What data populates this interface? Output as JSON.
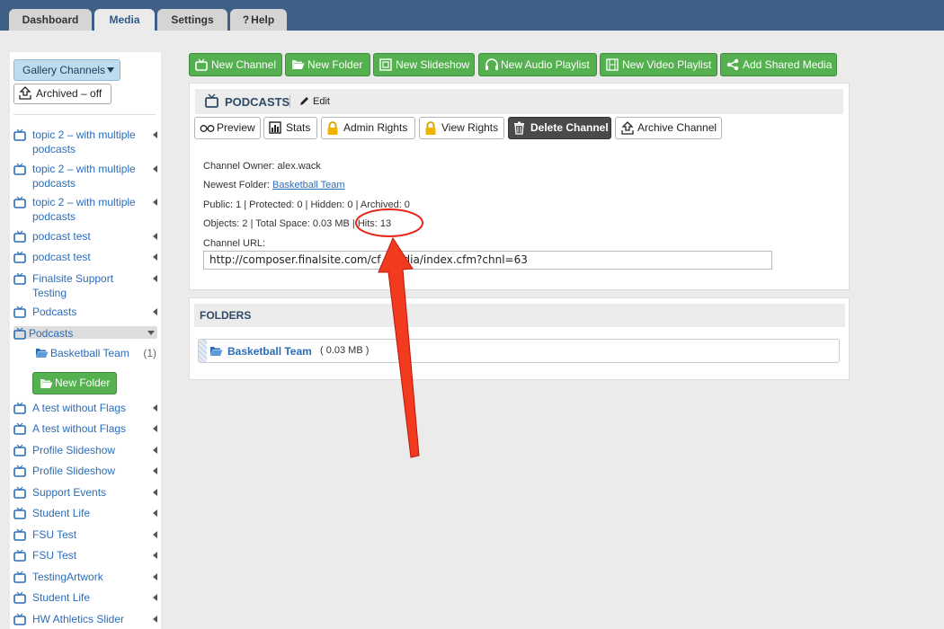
{
  "tabs": [
    {
      "label": "Dashboard",
      "active": false
    },
    {
      "label": "Media",
      "active": true
    },
    {
      "label": "Settings",
      "active": false
    },
    {
      "label": "Help",
      "active": false
    }
  ],
  "sidebar": {
    "gallery_label": "Gallery Channels",
    "archived_label": "Archived – off",
    "items": [
      {
        "label": "topic 2 – with multiple podcasts"
      },
      {
        "label": "topic 2 – with multiple podcasts"
      },
      {
        "label": "topic 2 – with multiple podcasts"
      },
      {
        "label": "podcast test"
      },
      {
        "label": "podcast test"
      },
      {
        "label": "Finalsite Support Testing"
      },
      {
        "label": "Podcasts"
      },
      {
        "label": "Podcasts"
      },
      {
        "label": "A test without Flags"
      },
      {
        "label": "A test without Flags"
      },
      {
        "label": "Profile Slideshow"
      },
      {
        "label": "Profile Slideshow"
      },
      {
        "label": "Support Events"
      },
      {
        "label": "Student Life"
      },
      {
        "label": "FSU Test"
      },
      {
        "label": "FSU Test"
      },
      {
        "label": "TestingArtwork"
      },
      {
        "label": "Student Life"
      },
      {
        "label": "HW Athletics Slider"
      }
    ],
    "sub_folder": {
      "label": "Basketball Team",
      "count": "(1)"
    },
    "new_folder_label": "New Folder"
  },
  "toolbar": {
    "new_channel": "New Channel",
    "new_folder": "New Folder",
    "new_slideshow": "New Slideshow",
    "new_audio_playlist": "New Audio Playlist",
    "new_video_playlist": "New Video Playlist",
    "add_shared_media": "Add Shared Media"
  },
  "channel": {
    "title": "PODCASTS",
    "edit_label": "Edit",
    "buttons": {
      "preview": "Preview",
      "stats": "Stats",
      "admin_rights": "Admin Rights",
      "view_rights": "View Rights",
      "delete_channel": "Delete Channel",
      "archive_channel": "Archive Channel"
    },
    "owner_text": "Channel Owner: alex.wack",
    "newest_folder_prefix": "Newest Folder: ",
    "newest_folder_link": "Basketball Team",
    "counts_text": "Public: 1 | Protected: 0 | Hidden: 0 | Archived: 0",
    "objects_text": "Objects: 2 | Total Space: 0.03 MB | Hits: 13",
    "url_label": "Channel URL:",
    "url_value": "http://composer.finalsite.com/cf_media/index.cfm?chnl=63"
  },
  "folders": {
    "title": "FOLDERS",
    "rows": [
      {
        "name": "Basketball Team",
        "size": "( 0.03 MB )"
      }
    ]
  },
  "colors": {
    "topbar": "#3f5f87",
    "green_button": "#55b04f",
    "link": "#2b6cb8",
    "annotation": "#e8271a"
  }
}
